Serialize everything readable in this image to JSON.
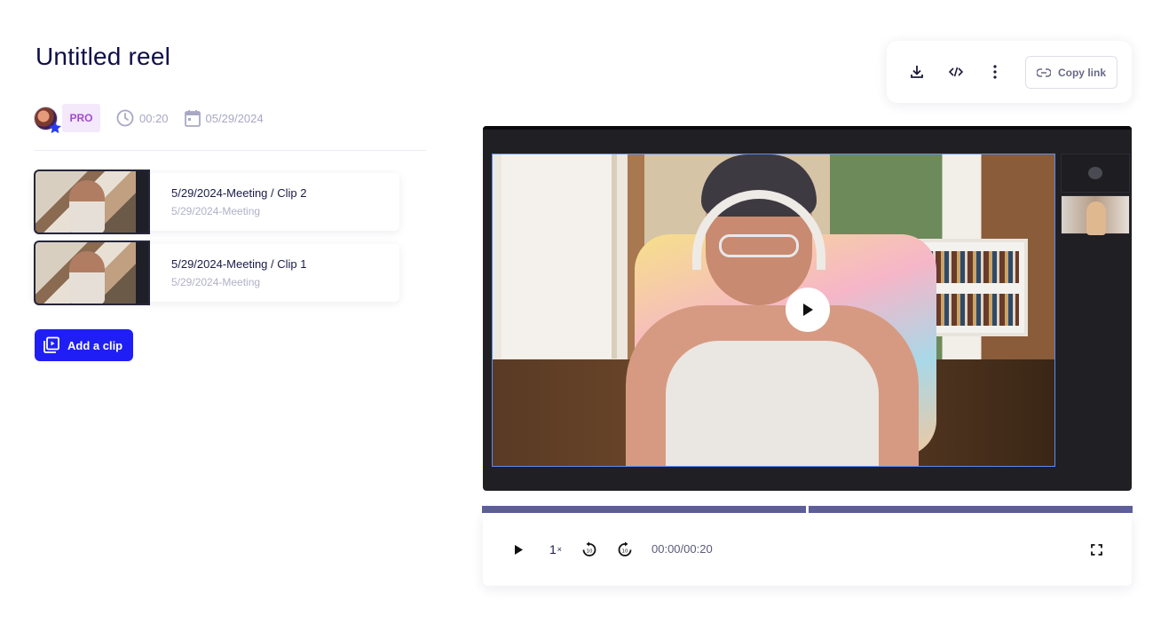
{
  "page": {
    "title": "Untitled reel"
  },
  "meta": {
    "plan_badge": "PRO",
    "duration": "00:20",
    "date": "05/29/2024"
  },
  "clips": [
    {
      "title": "5/29/2024-Meeting / Clip 2",
      "subtitle": "5/29/2024-Meeting"
    },
    {
      "title": "5/29/2024-Meeting / Clip 1",
      "subtitle": "5/29/2024-Meeting"
    }
  ],
  "actions": {
    "add_clip_label": "Add a clip",
    "copy_link_label": "Copy link"
  },
  "player": {
    "speed": "1",
    "speed_suffix": "×",
    "time_display": "00:00/00:20"
  },
  "colors": {
    "primary": "#1f1ff5",
    "title_text": "#0f0f48",
    "pro_badge_bg": "#f4e8fb",
    "pro_badge_text": "#a24cd0",
    "progress_bar": "#5f5f9a",
    "video_highlight": "#5b8cf0"
  },
  "icons": {
    "download": "download-icon",
    "embed": "code-icon",
    "more": "more-vertical-icon",
    "link": "link-icon",
    "clock": "clock-icon",
    "calendar": "calendar-icon",
    "add_clip": "video-add-icon",
    "play": "play-icon",
    "rewind": "rewind-10-icon",
    "forward": "forward-10-icon",
    "fullscreen": "fullscreen-icon"
  }
}
